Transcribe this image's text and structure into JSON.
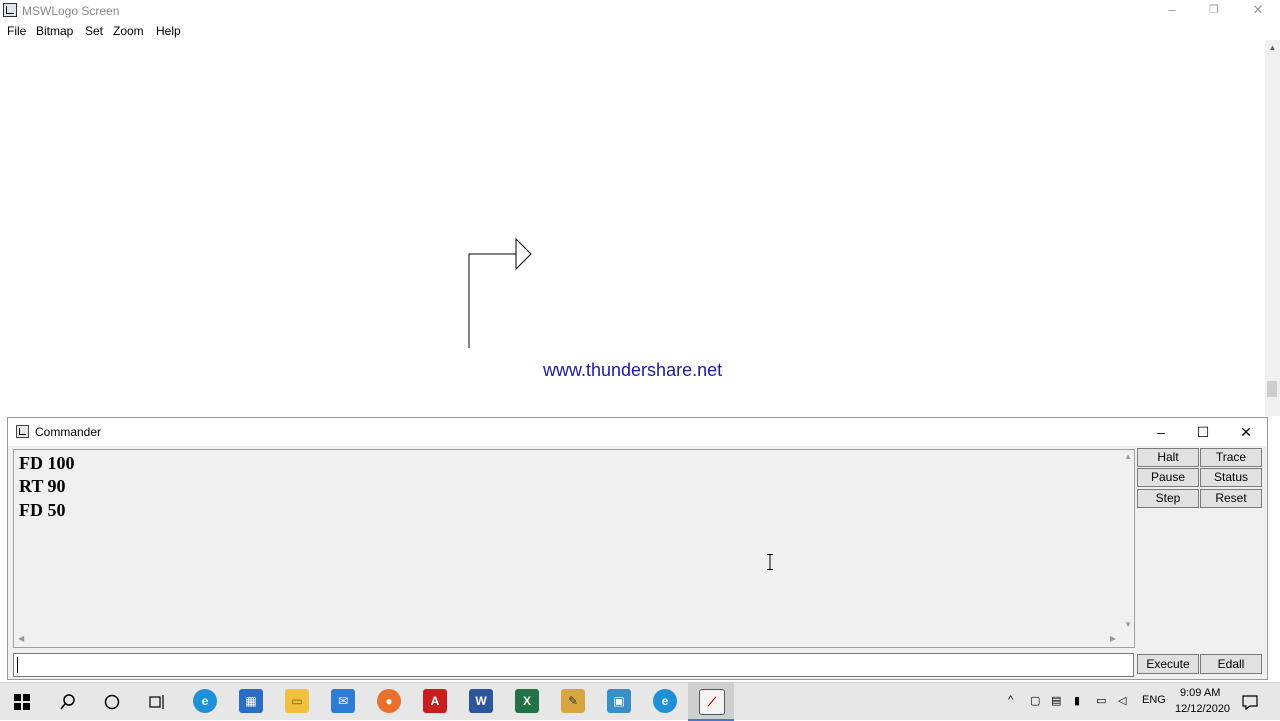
{
  "window": {
    "title": "MSWLogo Screen",
    "minimize": "–",
    "restore": "❐",
    "close": "✕"
  },
  "menu": [
    "File",
    "Bitmap",
    "Set",
    "Zoom",
    "Help"
  ],
  "canvas": {
    "watermark": "www.thundershare.net"
  },
  "commander": {
    "title": "Commander",
    "minimize": "–",
    "maximize": "☐",
    "close": "✕",
    "history": [
      "FD 100",
      "RT 90",
      "FD 50"
    ],
    "input_value": "",
    "buttons": {
      "halt": "Halt",
      "trace": "Trace",
      "pause": "Pause",
      "status": "Status",
      "step": "Step",
      "reset": "Reset",
      "execute": "Execute",
      "edall": "Edall"
    }
  },
  "taskbar": {
    "apps": [
      "start-icon",
      "search-icon",
      "cortana-icon",
      "task-view-icon",
      "edge-icon",
      "store-icon",
      "file-explorer-icon",
      "mail-icon",
      "firefox-icon",
      "acrobat-icon",
      "word-icon",
      "excel-icon",
      "pen-app-icon",
      "photos-icon",
      "ie-icon",
      "mswlogo-icon"
    ],
    "language": "ENG",
    "time": "9:09 AM",
    "date": "12/12/2020"
  }
}
